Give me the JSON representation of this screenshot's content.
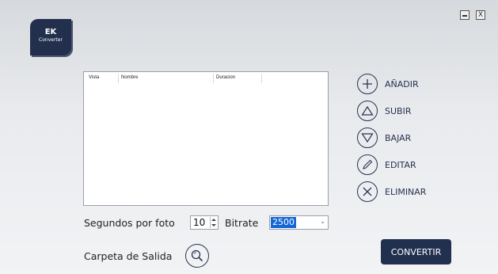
{
  "logo": {
    "line1": "EK",
    "line2": "Converter"
  },
  "window": {
    "close_label": "X"
  },
  "list": {
    "columns": [
      "Vista",
      "Nombre",
      "Duracion"
    ]
  },
  "actions": [
    {
      "label": "AÑADIR",
      "icon": "plus-icon"
    },
    {
      "label": "SUBIR",
      "icon": "triangle-up-icon"
    },
    {
      "label": "BAJAR",
      "icon": "triangle-down-icon"
    },
    {
      "label": "EDITAR",
      "icon": "pencil-icon"
    },
    {
      "label": "ELIMINAR",
      "icon": "x-icon"
    }
  ],
  "settings": {
    "seconds_label": "Segundos por foto",
    "seconds_value": "10",
    "bitrate_label": "Bitrate",
    "bitrate_value": "2500",
    "output_label": "Carpeta de Salida"
  },
  "convert_label": "CONVERTIR",
  "colors": {
    "accent": "#22304f",
    "selection": "#1467d6"
  }
}
